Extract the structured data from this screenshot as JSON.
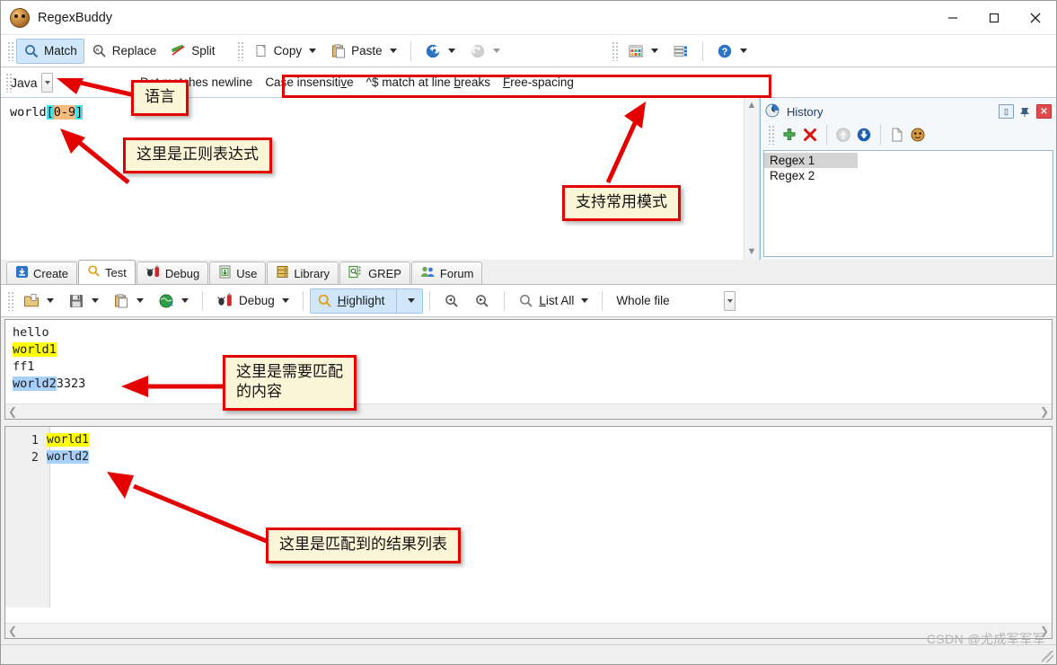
{
  "window": {
    "title": "RegexBuddy",
    "app_icon": "regexbuddy-tiger-icon",
    "minimize": "—",
    "maximize": "□",
    "close": "✕"
  },
  "toolbar": {
    "match": "Match",
    "replace": "Replace",
    "split": "Split",
    "copy": "Copy",
    "paste": "Paste",
    "undo_icon": "undo-icon",
    "redo_icon": "redo-icon",
    "layout_icon": "layout-icon",
    "list-icon": "list-icon",
    "help_icon": "help-icon"
  },
  "options": {
    "language": "Java",
    "items": [
      "Dot matches newline",
      "Case insensitive",
      "^$ match at line breaks",
      "Free-spacing"
    ]
  },
  "regex": {
    "prefix": "world",
    "open_bracket": "[",
    "range": "0-9",
    "close_bracket": "]",
    "full": "world[0-9]"
  },
  "history": {
    "title": "History",
    "clock_icon": "history-clock-icon",
    "add_icon": "add-icon",
    "delete_icon": "delete-icon",
    "up_icon": "move-up-icon",
    "down_icon": "move-down-icon",
    "new_icon": "new-document-icon",
    "app_icon": "regexbuddy-tiger-icon",
    "items": [
      "Regex 1",
      "Regex 2"
    ],
    "selected": "Regex 1",
    "minimize_btn": "▭",
    "pin_btn": "⚐",
    "close_btn": "✕"
  },
  "tabs": [
    {
      "label": "Create",
      "icon": "create-icon",
      "active": false
    },
    {
      "label": "Test",
      "icon": "test-magnifier-icon",
      "active": true
    },
    {
      "label": "Debug",
      "icon": "debug-bug-icon",
      "active": false
    },
    {
      "label": "Use",
      "icon": "use-export-icon",
      "active": false
    },
    {
      "label": "Library",
      "icon": "library-icon",
      "active": false
    },
    {
      "label": "GREP",
      "icon": "grep-icon",
      "active": false
    },
    {
      "label": "Forum",
      "icon": "forum-people-icon",
      "active": false
    }
  ],
  "testbar": {
    "open_icon": "open-folder-icon",
    "save_icon": "save-disk-icon",
    "paste_icon": "paste-icon",
    "web_icon": "globe-icon",
    "debug": "Debug",
    "highlight": "Highlight",
    "find_prev_icon": "find-previous-icon",
    "find_next_icon": "find-next-icon",
    "list_all": "List All",
    "scope": "Whole file"
  },
  "subject": {
    "lines": [
      {
        "text": "hello",
        "highlight": "none"
      },
      {
        "text": "world1",
        "highlight": "yellow"
      },
      {
        "text": "ff1",
        "highlight": "none"
      },
      {
        "text": "world2",
        "highlight": "blue",
        "tail": "3323"
      }
    ]
  },
  "results": {
    "rows": [
      {
        "num": "1",
        "text": "world1",
        "highlight": "yellow"
      },
      {
        "num": "2",
        "text": "world2",
        "highlight": "blue"
      }
    ]
  },
  "annotations": [
    {
      "id": "language-note",
      "text": "语言"
    },
    {
      "id": "regex-note",
      "text": "这里是正则表达式"
    },
    {
      "id": "modes-note",
      "text": "支持常用模式"
    },
    {
      "id": "subject-note",
      "text": "这里是需要匹配\n的内容"
    },
    {
      "id": "results-note",
      "text": "这里是匹配到的结果列表"
    }
  ],
  "watermark": "CSDN @尤成军军军",
  "colors": {
    "annotation_border": "#e50000",
    "annotation_bg": "#fcf6d8",
    "match_yellow": "#ffff00",
    "match_blue": "#a8d0fb",
    "token_bracket": "#44e0e6",
    "token_range": "#f6bb7f",
    "active_tool": "#cfe6fb"
  }
}
